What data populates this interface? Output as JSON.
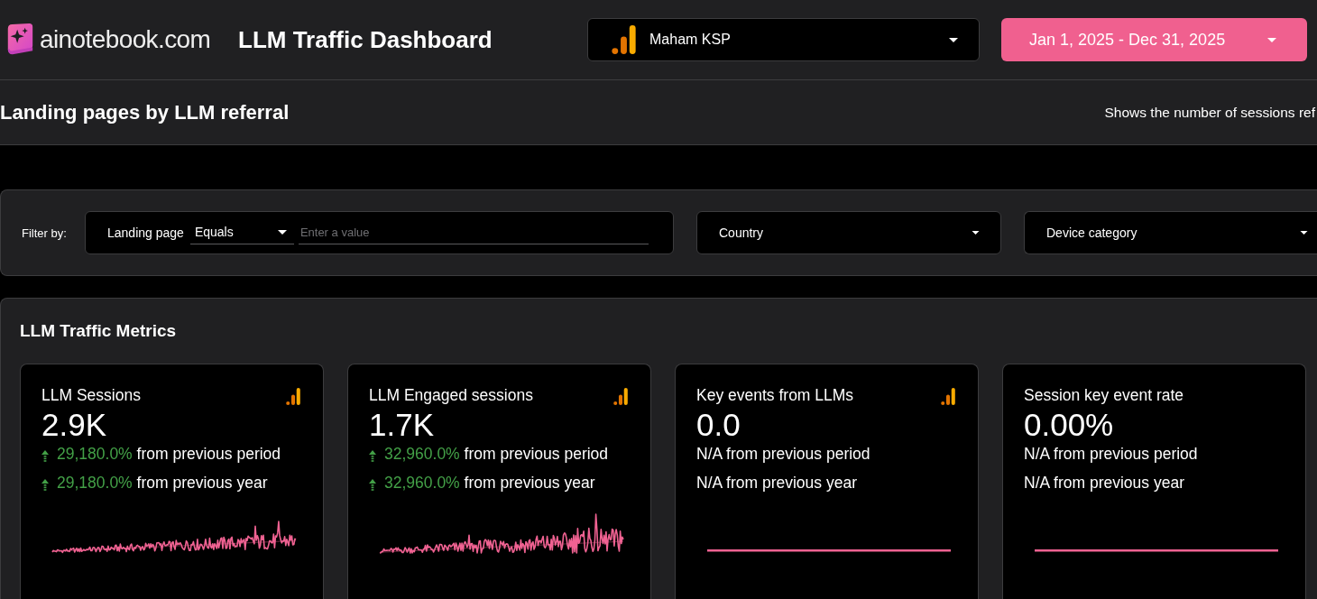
{
  "header": {
    "logo_text": "ainotebook.com",
    "title": "LLM Traffic Dashboard",
    "account_selector": {
      "label": "Maham KSP"
    },
    "date_range": {
      "label": "Jan 1, 2025 - Dec 31, 2025"
    }
  },
  "section": {
    "title": "Landing pages by LLM referral",
    "description": "Shows the number of sessions ref"
  },
  "filters": {
    "label": "Filter by:",
    "landing_page": {
      "label": "Landing page",
      "operator": "Equals",
      "placeholder": "Enter a value"
    },
    "dropdowns": [
      {
        "label": "Country"
      },
      {
        "label": "Device category"
      }
    ]
  },
  "metrics": {
    "title": "LLM Traffic Metrics",
    "cards": [
      {
        "kind": "rising",
        "title": "LLM Sessions",
        "value": "2.9K",
        "analytics_icon": true,
        "changes": [
          {
            "up": true,
            "text": "29,180.0% from previous period"
          },
          {
            "up": true,
            "text": "29,180.0% from previous year"
          }
        ]
      },
      {
        "kind": "rising",
        "title": "LLM Engaged sessions",
        "value": "1.7K",
        "analytics_icon": true,
        "changes": [
          {
            "up": true,
            "text": "32,960.0% from previous period"
          },
          {
            "up": true,
            "text": "32,960.0% from previous year"
          }
        ]
      },
      {
        "kind": "flat",
        "title": "Key events from LLMs",
        "value": "0.0",
        "analytics_icon": true,
        "changes": [
          {
            "up": false,
            "text": "N/A from previous period"
          },
          {
            "up": false,
            "text": "N/A from previous year"
          }
        ]
      },
      {
        "kind": "flat",
        "title": "Session key event rate",
        "value": "0.00%",
        "analytics_icon": false,
        "changes": [
          {
            "up": false,
            "text": "N/A from previous period"
          },
          {
            "up": false,
            "text": "N/A from previous year"
          }
        ]
      }
    ]
  }
}
